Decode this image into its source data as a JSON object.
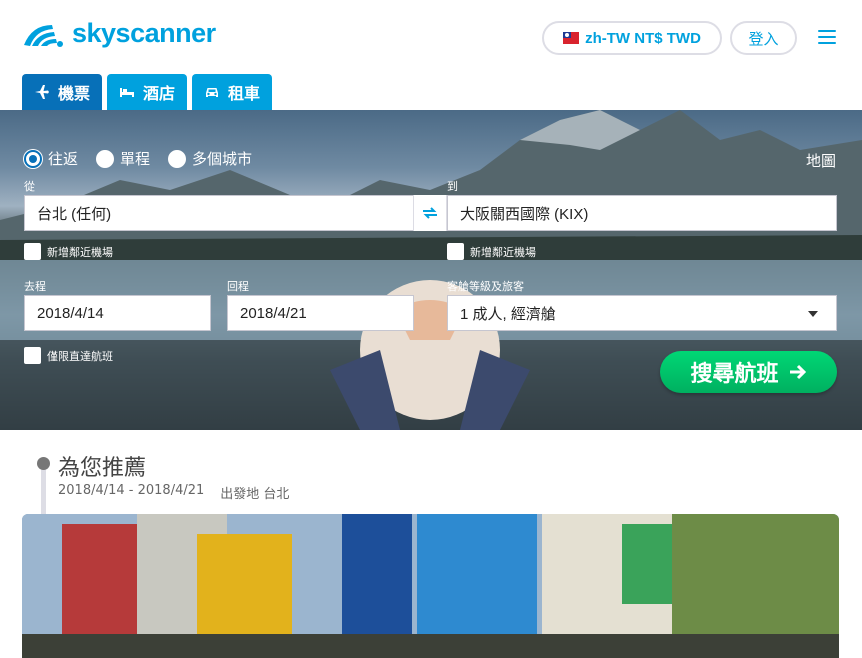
{
  "brand": {
    "name": "skyscanner",
    "color": "#00a1de"
  },
  "header": {
    "locale_label": "zh-TW NT$ TWD",
    "login_label": "登入"
  },
  "tabs": [
    {
      "label": "機票",
      "icon": "plane-icon",
      "active": true
    },
    {
      "label": "酒店",
      "icon": "bed-icon",
      "active": false
    },
    {
      "label": "租車",
      "icon": "car-icon",
      "active": false
    }
  ],
  "search": {
    "trip_types": [
      {
        "label": "往返",
        "selected": true
      },
      {
        "label": "單程",
        "selected": false
      },
      {
        "label": "多個城市",
        "selected": false
      }
    ],
    "map_label": "地圖",
    "from_label": "從",
    "from_value": "台北 (任何)",
    "to_label": "到",
    "to_value": "大阪關西國際 (KIX)",
    "nearby_from_label": "新增鄰近機場",
    "nearby_to_label": "新增鄰近機場",
    "depart_label": "去程",
    "depart_value": "2018/4/14",
    "return_label": "回程",
    "return_value": "2018/4/21",
    "cabin_label": "客艙等級及旅客",
    "cabin_value": "1 成人, 經濟艙",
    "direct_only_label": "僅限直達航班",
    "submit_label": "搜尋航班",
    "submit_color": "#00c46a"
  },
  "recommended": {
    "title": "為您推薦",
    "dates": "2018/4/14 - 2018/4/21",
    "origin": "出發地 台北"
  }
}
